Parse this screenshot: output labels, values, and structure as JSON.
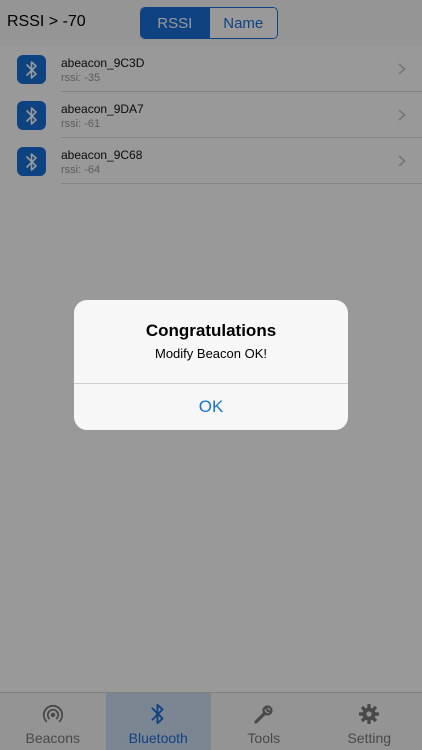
{
  "header": {
    "rssi_filter": "RSSI > -70",
    "segments": [
      "RSSI",
      "Name"
    ],
    "selected_segment": "RSSI"
  },
  "devices": [
    {
      "name": "abeacon_9C3D",
      "rssi": "rssi: -35",
      "icon": "bluetooth-icon"
    },
    {
      "name": "abeacon_9DA7",
      "rssi": "rssi: -61",
      "icon": "bluetooth-icon"
    },
    {
      "name": "abeacon_9C68",
      "rssi": "rssi: -64",
      "icon": "bluetooth-icon"
    }
  ],
  "tabs": [
    {
      "label": "Beacons",
      "icon": "beacon-icon"
    },
    {
      "label": "Bluetooth",
      "icon": "bluetooth-icon"
    },
    {
      "label": "Tools",
      "icon": "wrench-icon"
    },
    {
      "label": "Setting",
      "icon": "gear-icon"
    }
  ],
  "selected_tab": "Bluetooth",
  "alert": {
    "title": "Congratulations",
    "message": "Modify Beacon OK!",
    "button": "OK"
  },
  "colors": {
    "accent": "#1a6fd8",
    "overlay": "rgba(0,0,0,0.4)"
  }
}
